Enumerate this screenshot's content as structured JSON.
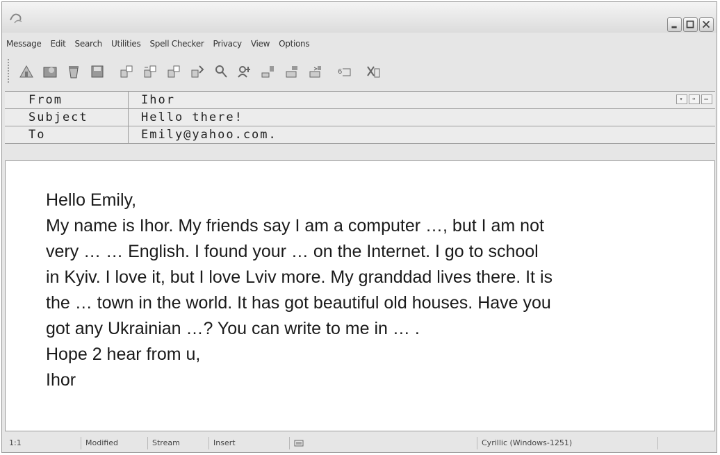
{
  "menu": [
    "Message",
    "Edit",
    "Search",
    "Utilities",
    "Spell Checker",
    "Privacy",
    "View",
    "Options"
  ],
  "toolbar_icons": [
    "send-icon",
    "attach-icon",
    "trash-icon",
    "save-icon",
    "copy-icon",
    "paste-icon",
    "quote-icon",
    "insert-icon",
    "search-people-icon",
    "address-book-icon",
    "sign-icon",
    "encrypt-icon",
    "decrypt-icon",
    "spell-icon",
    "cancel-icon"
  ],
  "headers": {
    "from_label": "From",
    "from_value": "Ihor",
    "subject_label": "Subject",
    "subject_value": "Hello there!",
    "to_label": "To",
    "to_value": "Emily@yahoo.com."
  },
  "message_lines": [
    "Hello Emily,",
    "My name is Ihor. My friends say I am a computer …, but I am not",
    "very … … English. I found your … on the Internet. I go to school",
    "in Kyiv. I love it, but I love Lviv more. My granddad lives there. It is",
    "the … town in the world. It has got beautiful old houses. Have you",
    "got any Ukrainian …? You can write to me in … .",
    "Hope 2 hear from u,",
    "Ihor"
  ],
  "status": {
    "position": "1:1",
    "modified": "Modified",
    "mode": "Stream",
    "insert": "Insert",
    "encoding": "Cyrillic (Windows-1251)"
  }
}
